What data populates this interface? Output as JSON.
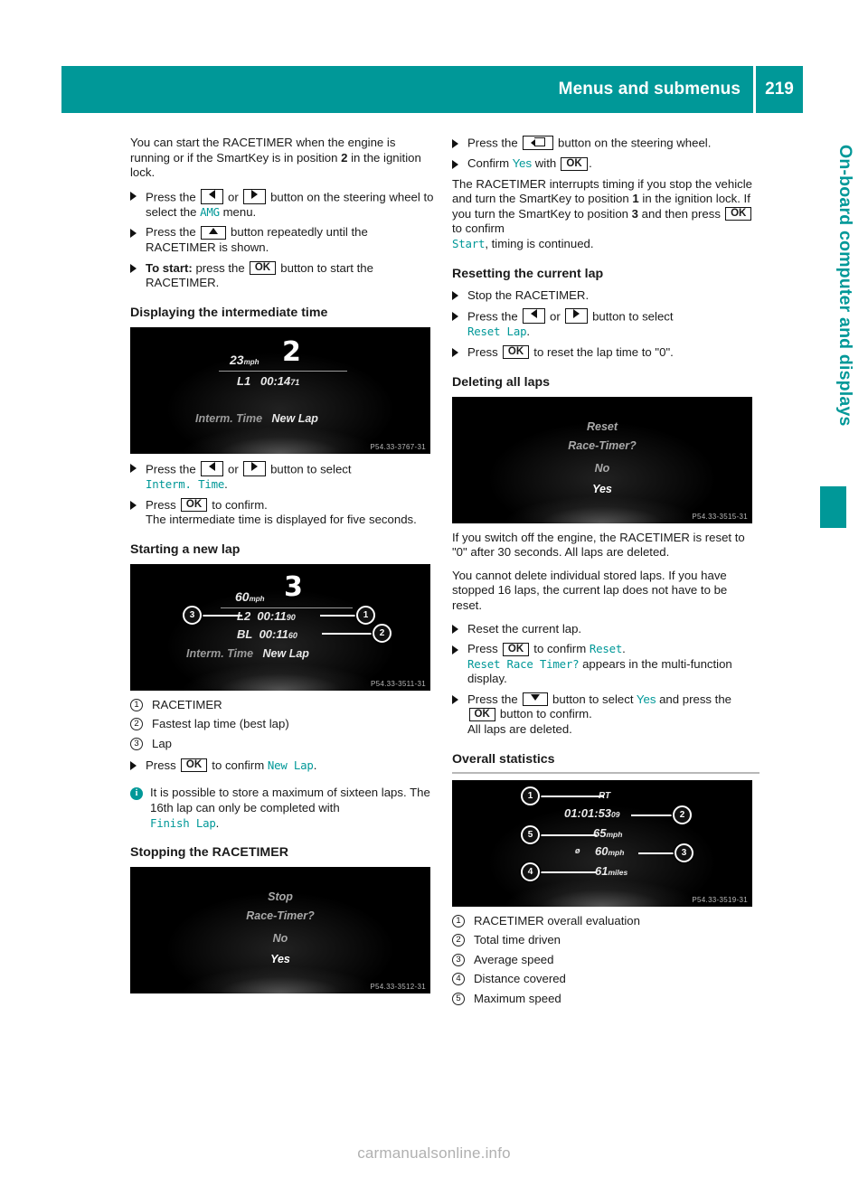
{
  "header": {
    "title": "Menus and submenus",
    "page_number": "219"
  },
  "side_tab": {
    "label": "On-board computer and displays"
  },
  "watermark": "carmanualsonline.info",
  "left_column": {
    "intro": {
      "p1_a": "You can start the RACETIMER when the engine is running or if the SmartKey is in position ",
      "p1_b": "2",
      "p1_c": " in the ignition lock."
    },
    "steps_start": [
      {
        "a": "Press the ",
        "key1": "left-arrow",
        "b": " or ",
        "key2": "right-arrow",
        "c": " button on the steering wheel to select the ",
        "disp": "AMG",
        "d": " menu."
      },
      {
        "a": "Press the ",
        "key1": "up-arrow",
        "c": " button repeatedly until the RACETIMER is shown."
      },
      {
        "bold": "To start:",
        "a": " press the ",
        "key1": "OK",
        "c": " button to start the RACETIMER."
      }
    ],
    "section_intermediate": "Displaying the intermediate time",
    "fig_intermediate": {
      "lap_number": "2",
      "speed": "23",
      "speed_unit": "mph",
      "lap_label": "L1",
      "lap_time": "00:14",
      "lap_time_frac": "71",
      "menu_left": "Interm. Time",
      "menu_right": "New Lap",
      "code": "P54.33-3767-31"
    },
    "steps_intermediate": [
      {
        "a": "Press the ",
        "key1": "left-arrow",
        "b": " or ",
        "key2": "right-arrow",
        "c": " button to select ",
        "disp": "Interm. Time",
        "d": "."
      },
      {
        "a": "Press ",
        "key1": "OK",
        "c": " to confirm.",
        "sub": "The intermediate time is displayed for five seconds."
      }
    ],
    "section_newlap": "Starting a new lap",
    "fig_newlap": {
      "lap_number": "3",
      "speed": "60",
      "speed_unit": "mph",
      "row1_label": "L2",
      "row1_time": "00:11",
      "row1_frac": "90",
      "row2_label": "BL",
      "row2_time": "00:11",
      "row2_frac": "60",
      "menu_left": "Interm. Time",
      "menu_right": "New Lap",
      "code": "P54.33-3511-31",
      "callouts": [
        "1",
        "2",
        "3"
      ]
    },
    "callouts_newlap": [
      {
        "n": "1",
        "text": "RACETIMER"
      },
      {
        "n": "2",
        "text": "Fastest lap time (best lap)"
      },
      {
        "n": "3",
        "text": "Lap"
      }
    ],
    "step_newlap_confirm": {
      "a": "Press ",
      "key1": "OK",
      "c": " to confirm ",
      "disp": "New Lap",
      "d": "."
    },
    "note": {
      "a": "It is possible to store a maximum of sixteen laps. The 16th lap can only be completed with ",
      "disp": "Finish Lap",
      "b": "."
    },
    "section_stopping": "Stopping the RACETIMER",
    "fig_stopping": {
      "line1": "Stop",
      "line2": "Race-Timer?",
      "line3": "No",
      "line4": "Yes",
      "code": "P54.33-3512-31"
    }
  },
  "right_column": {
    "steps_stop": [
      {
        "a": "Press the ",
        "key1": "back",
        "c": " button on the steering wheel."
      },
      {
        "a": "Confirm ",
        "disp": "Yes",
        "b": " with ",
        "key1": "OK",
        "c": "."
      }
    ],
    "para_interrupt": {
      "t1": "The RACETIMER interrupts timing if you stop the vehicle and turn the SmartKey to position ",
      "b1": "1",
      "t2": " in the ignition lock. If you turn the SmartKey to position ",
      "b2": "3",
      "t3": " and then press ",
      "key": "OK",
      "t4": " to confirm ",
      "disp": "Start",
      "t5": ", timing is continued."
    },
    "section_reset_lap": "Resetting the current lap",
    "steps_reset_lap": [
      {
        "a": "Stop the RACETIMER."
      },
      {
        "a": "Press the ",
        "key1": "left-arrow",
        "b": " or ",
        "key2": "right-arrow",
        "c": " button to select ",
        "disp": "Reset Lap",
        "d": "."
      },
      {
        "a": "Press ",
        "key1": "OK",
        "c": " to reset the lap time to \"0\"."
      }
    ],
    "section_delete_laps": "Deleting all laps",
    "fig_delete": {
      "line1": "Reset",
      "line2": "Race-Timer?",
      "line3": "No",
      "line4": "Yes",
      "code": "P54.33-3515-31"
    },
    "para_switchoff": "If you switch off the engine, the RACETIMER is reset to \"0\" after 30 seconds. All laps are deleted.",
    "para_individual": "You cannot delete individual stored laps. If you have stopped 16 laps, the current lap does not have to be reset.",
    "steps_delete": [
      {
        "a": "Reset the current lap."
      },
      {
        "a": "Press ",
        "key1": "OK",
        "c": " to confirm ",
        "disp": "Reset",
        "d": ".",
        "sub_disp": "Reset Race Timer?",
        "sub_after": " appears in the multi-function display."
      },
      {
        "a": "Press the ",
        "key1": "down-arrow",
        "c": " button to select ",
        "disp": "Yes",
        "d": " and press the ",
        "key2": "OK",
        "e": " button to confirm.",
        "sub": "All laps are deleted."
      }
    ],
    "section_overall": "Overall statistics",
    "fig_overall": {
      "rt_label": "RT",
      "total_time": "01:01:53",
      "total_time_frac": "09",
      "max_speed": "65",
      "max_speed_unit": "mph",
      "avg_symbol": "ø",
      "avg_speed": "60",
      "avg_speed_unit": "mph",
      "distance": "61",
      "distance_unit": "miles",
      "code": "P54.33-3519-31",
      "callouts": [
        "1",
        "2",
        "3",
        "4",
        "5"
      ]
    },
    "callouts_overall": [
      {
        "n": "1",
        "text": "RACETIMER overall evaluation"
      },
      {
        "n": "2",
        "text": "Total time driven"
      },
      {
        "n": "3",
        "text": "Average speed"
      },
      {
        "n": "4",
        "text": "Distance covered"
      },
      {
        "n": "5",
        "text": "Maximum speed"
      }
    ]
  },
  "colors": {
    "accent": "#009898",
    "text": "#1a1a1a"
  }
}
